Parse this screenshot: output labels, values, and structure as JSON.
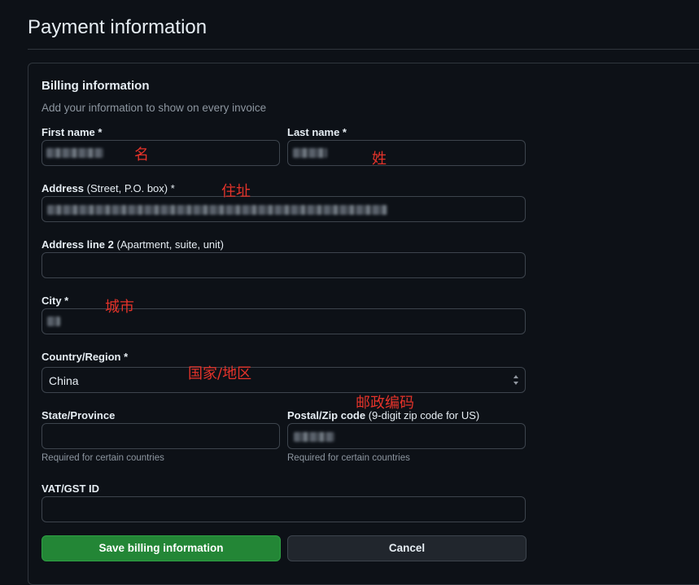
{
  "page": {
    "title": "Payment information"
  },
  "billing": {
    "title": "Billing information",
    "description": "Add your information to show on every invoice",
    "first_name": {
      "label": "First name *",
      "value": ""
    },
    "last_name": {
      "label": "Last name *",
      "value": ""
    },
    "address": {
      "label": "Address",
      "hint": " (Street, P.O. box) *",
      "value": ""
    },
    "address2": {
      "label": "Address line 2",
      "hint": " (Apartment, suite, unit)",
      "value": ""
    },
    "city": {
      "label": "City *",
      "value": ""
    },
    "country": {
      "label": "Country/Region *",
      "value": "China"
    },
    "state": {
      "label": "State/Province",
      "help": "Required for certain countries",
      "value": ""
    },
    "postal": {
      "label": "Postal/Zip code",
      "hint": " (9-digit zip code for US)",
      "help": "Required for certain countries",
      "value": ""
    },
    "vat": {
      "label": "VAT/GST ID",
      "value": ""
    }
  },
  "annotations": {
    "first_name": "名",
    "last_name": "姓",
    "address": "住址",
    "city": "城市",
    "country": "国家/地区",
    "postal": "邮政编码"
  },
  "buttons": {
    "save": "Save billing information",
    "cancel": "Cancel"
  },
  "colors": {
    "accent_green": "#238636",
    "annotation_red": "#e5332a",
    "background": "#0d1117"
  }
}
